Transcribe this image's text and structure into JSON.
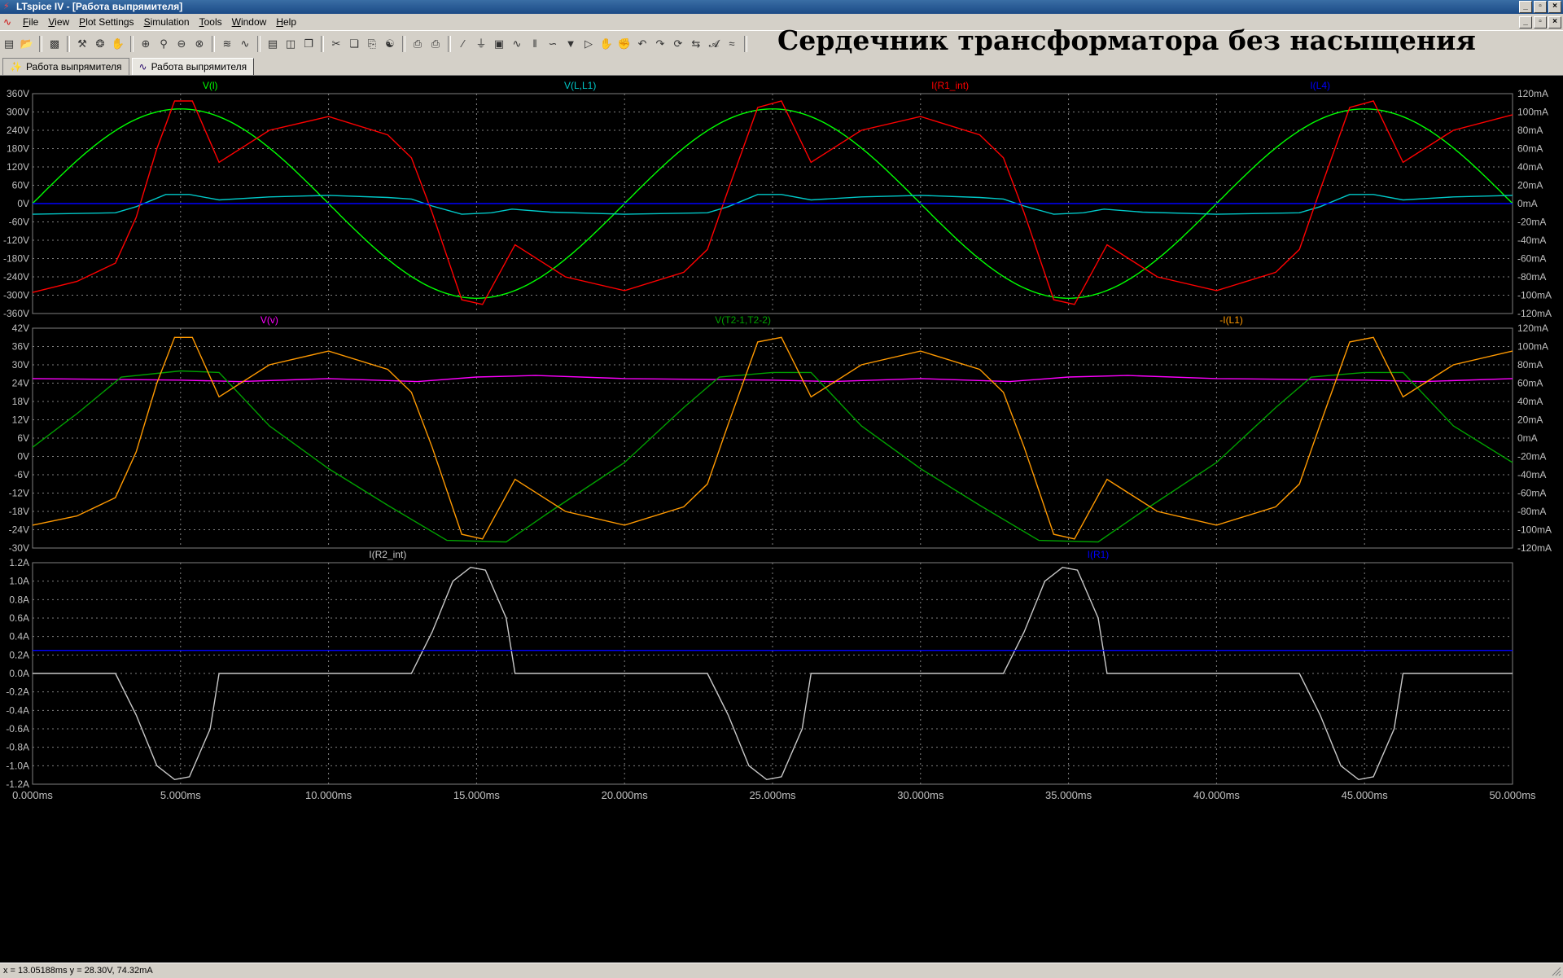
{
  "window": {
    "title": "LTspice IV - [Работа выпрямителя]",
    "controls": [
      "_",
      "▫",
      "×"
    ]
  },
  "menu": {
    "items": [
      "File",
      "View",
      "Plot Settings",
      "Simulation",
      "Tools",
      "Window",
      "Help"
    ]
  },
  "toolbar": {
    "banner": "Сердечник трансформатора без насыщения",
    "icons": [
      "new-schematic-icon",
      "open-icon",
      "save-icon",
      "control-panel-icon",
      "run-icon",
      "halt-icon",
      "zoom-in-icon",
      "zoom-back-icon",
      "zoom-out-icon",
      "zoom-fit-icon",
      "autorange-icon",
      "split-icon",
      "tile-h-icon",
      "tile-v-icon",
      "cascade-icon",
      "cut-icon",
      "copy-icon",
      "paste-icon",
      "find-icon",
      "print-preview-icon",
      "print-icon",
      "wire-icon",
      "ground-icon",
      "label-icon",
      "resistor-icon",
      "capacitor-icon",
      "inductor-icon",
      "diode-icon",
      "component-icon",
      "move-icon",
      "drag-icon",
      "undo-icon",
      "redo-icon",
      "rotate-icon",
      "mirror-icon",
      "text-icon",
      "spice-directive-icon"
    ]
  },
  "tabs": [
    {
      "label": "Работа выпрямителя",
      "icon": "schematic-tab-icon"
    },
    {
      "label": "Работа выпрямителя",
      "icon": "waveform-tab-icon"
    }
  ],
  "status": {
    "cursor": "x = 13.05188ms   y = 28.30V, 74.32mA"
  },
  "chart_data": [
    {
      "type": "line",
      "panel": "top",
      "left_axis": {
        "unit": "V",
        "ylim": [
          -360,
          360
        ],
        "ticks": [
          "360V",
          "300V",
          "240V",
          "180V",
          "120V",
          "60V",
          "0V",
          "-60V",
          "-120V",
          "-180V",
          "-240V",
          "-300V",
          "-360V"
        ]
      },
      "right_axis": {
        "unit": "mA",
        "ylim": [
          -120,
          120
        ],
        "ticks": [
          "120mA",
          "100mA",
          "80mA",
          "60mA",
          "40mA",
          "20mA",
          "0mA",
          "-20mA",
          "-40mA",
          "-60mA",
          "-80mA",
          "-100mA",
          "-120mA"
        ]
      },
      "x": {
        "unit": "ms",
        "xlim": [
          0,
          50
        ]
      },
      "grid": true,
      "series": [
        {
          "name": "V(l)",
          "color": "#00ff00",
          "axis": "left",
          "shape": "sine",
          "amplitude": 310,
          "period_ms": 20,
          "phase_ms": 0
        },
        {
          "name": "V(L,L1)",
          "color": "#00c8c8",
          "axis": "left",
          "shape": "small-distorted",
          "points": [
            [
              0,
              -35
            ],
            [
              2.8,
              -30
            ],
            [
              3.5,
              -10
            ],
            [
              4.5,
              30
            ],
            [
              5.3,
              30
            ],
            [
              6.3,
              12
            ],
            [
              8,
              22
            ],
            [
              10,
              27
            ],
            [
              12,
              20
            ],
            [
              12.8,
              15
            ],
            [
              13.5,
              -8
            ],
            [
              14.5,
              -35
            ],
            [
              15.5,
              -30
            ],
            [
              16.2,
              -18
            ],
            [
              17.5,
              -28
            ],
            [
              20,
              -35
            ],
            [
              22.8,
              -30
            ],
            [
              23.5,
              -10
            ],
            [
              24.5,
              30
            ],
            [
              25.3,
              30
            ],
            [
              26.3,
              12
            ],
            [
              28,
              22
            ],
            [
              30,
              27
            ],
            [
              32,
              20
            ],
            [
              32.8,
              15
            ],
            [
              33.5,
              -8
            ],
            [
              34.5,
              -35
            ],
            [
              35.5,
              -30
            ],
            [
              36.2,
              -18
            ],
            [
              37.5,
              -28
            ],
            [
              40,
              -35
            ],
            [
              42.8,
              -30
            ],
            [
              43.5,
              -10
            ],
            [
              44.5,
              30
            ],
            [
              45.3,
              30
            ],
            [
              46.3,
              12
            ],
            [
              48,
              22
            ],
            [
              50,
              27
            ]
          ]
        },
        {
          "name": "I(R1_int)",
          "color": "#ff0000",
          "axis": "right",
          "points": [
            [
              0,
              -97
            ],
            [
              1.5,
              -85
            ],
            [
              2.8,
              -65
            ],
            [
              3.5,
              -15
            ],
            [
              4.2,
              60
            ],
            [
              4.8,
              112
            ],
            [
              5.4,
              112
            ],
            [
              6.3,
              45
            ],
            [
              8,
              80
            ],
            [
              10,
              95
            ],
            [
              12,
              75
            ],
            [
              12.8,
              50
            ],
            [
              13.5,
              -10
            ],
            [
              14.5,
              -105
            ],
            [
              15.2,
              -110
            ],
            [
              16.3,
              -45
            ],
            [
              18,
              -80
            ],
            [
              20,
              -95
            ],
            [
              22,
              -75
            ],
            [
              22.8,
              -50
            ],
            [
              23.5,
              15
            ],
            [
              24.5,
              105
            ],
            [
              25.3,
              112
            ],
            [
              26.3,
              45
            ],
            [
              28,
              80
            ],
            [
              30,
              95
            ],
            [
              32,
              75
            ],
            [
              32.8,
              50
            ],
            [
              33.5,
              -10
            ],
            [
              34.5,
              -105
            ],
            [
              35.2,
              -110
            ],
            [
              36.3,
              -45
            ],
            [
              38,
              -80
            ],
            [
              40,
              -95
            ],
            [
              42,
              -75
            ],
            [
              42.8,
              -50
            ],
            [
              43.5,
              15
            ],
            [
              44.5,
              105
            ],
            [
              45.3,
              112
            ],
            [
              46.3,
              45
            ],
            [
              48,
              80
            ],
            [
              50,
              97
            ]
          ]
        },
        {
          "name": "I(L4)",
          "color": "#0000ff",
          "axis": "right",
          "points": [
            [
              0,
              0
            ],
            [
              50,
              0
            ]
          ]
        }
      ]
    },
    {
      "type": "line",
      "panel": "middle",
      "left_axis": {
        "unit": "V",
        "ylim": [
          -30,
          42
        ],
        "ticks": [
          "42V",
          "36V",
          "30V",
          "24V",
          "18V",
          "12V",
          "6V",
          "0V",
          "-6V",
          "-12V",
          "-18V",
          "-24V",
          "-30V"
        ]
      },
      "right_axis": {
        "unit": "mA",
        "ylim": [
          -120,
          120
        ],
        "ticks": [
          "120mA",
          "100mA",
          "80mA",
          "60mA",
          "40mA",
          "20mA",
          "0mA",
          "-20mA",
          "-40mA",
          "-60mA",
          "-80mA",
          "-100mA",
          "-120mA"
        ]
      },
      "x": {
        "unit": "ms",
        "xlim": [
          0,
          50
        ]
      },
      "grid": true,
      "series": [
        {
          "name": "V(v)",
          "color": "#ff00ff",
          "axis": "left",
          "points": [
            [
              0,
              25.5
            ],
            [
              5,
              25
            ],
            [
              7,
              24.5
            ],
            [
              10,
              25.5
            ],
            [
              13,
              24.5
            ],
            [
              15,
              26
            ],
            [
              17,
              26.5
            ],
            [
              20,
              25.5
            ],
            [
              25,
              25
            ],
            [
              27,
              24.5
            ],
            [
              30,
              25.5
            ],
            [
              33,
              24.5
            ],
            [
              35,
              26
            ],
            [
              37,
              26.5
            ],
            [
              40,
              25.5
            ],
            [
              45,
              25
            ],
            [
              47,
              24.5
            ],
            [
              50,
              25.5
            ]
          ]
        },
        {
          "name": "V(T2-1,T2-2)",
          "color": "#00a000",
          "axis": "left",
          "points": [
            [
              0,
              3
            ],
            [
              1.5,
              14
            ],
            [
              3,
              26
            ],
            [
              5,
              28
            ],
            [
              6.3,
              27.5
            ],
            [
              8,
              10
            ],
            [
              10,
              -4
            ],
            [
              12,
              -16
            ],
            [
              14,
              -27.5
            ],
            [
              16,
              -28
            ],
            [
              17.5,
              -18
            ],
            [
              20,
              -2
            ],
            [
              22,
              16
            ],
            [
              23.2,
              26
            ],
            [
              25,
              27.5
            ],
            [
              26.3,
              27.5
            ],
            [
              28,
              10
            ],
            [
              30,
              -4
            ],
            [
              32,
              -16
            ],
            [
              34,
              -27.5
            ],
            [
              36,
              -28
            ],
            [
              37.5,
              -18
            ],
            [
              40,
              -2
            ],
            [
              42,
              16
            ],
            [
              43.2,
              26
            ],
            [
              45,
              27.5
            ],
            [
              46.3,
              27.5
            ],
            [
              48,
              10
            ],
            [
              50,
              -2
            ]
          ]
        },
        {
          "name": "-I(L1)",
          "color": "#ff9900",
          "axis": "right",
          "points": [
            [
              0,
              -95
            ],
            [
              1.5,
              -85
            ],
            [
              2.8,
              -65
            ],
            [
              3.5,
              -15
            ],
            [
              4.2,
              60
            ],
            [
              4.8,
              110
            ],
            [
              5.4,
              110
            ],
            [
              6.3,
              45
            ],
            [
              8,
              80
            ],
            [
              10,
              95
            ],
            [
              12,
              75
            ],
            [
              12.8,
              50
            ],
            [
              13.5,
              -10
            ],
            [
              14.5,
              -105
            ],
            [
              15.2,
              -110
            ],
            [
              16.3,
              -45
            ],
            [
              18,
              -80
            ],
            [
              20,
              -95
            ],
            [
              22,
              -75
            ],
            [
              22.8,
              -50
            ],
            [
              23.5,
              15
            ],
            [
              24.5,
              105
            ],
            [
              25.3,
              110
            ],
            [
              26.3,
              45
            ],
            [
              28,
              80
            ],
            [
              30,
              95
            ],
            [
              32,
              75
            ],
            [
              32.8,
              50
            ],
            [
              33.5,
              -10
            ],
            [
              34.5,
              -105
            ],
            [
              35.2,
              -110
            ],
            [
              36.3,
              -45
            ],
            [
              38,
              -80
            ],
            [
              40,
              -95
            ],
            [
              42,
              -75
            ],
            [
              42.8,
              -50
            ],
            [
              43.5,
              15
            ],
            [
              44.5,
              105
            ],
            [
              45.3,
              110
            ],
            [
              46.3,
              45
            ],
            [
              48,
              80
            ],
            [
              50,
              95
            ]
          ]
        }
      ]
    },
    {
      "type": "line",
      "panel": "bottom",
      "left_axis": {
        "unit": "A",
        "ylim": [
          -1.2,
          1.2
        ],
        "ticks": [
          "1.2A",
          "1.0A",
          "0.8A",
          "0.6A",
          "0.4A",
          "0.2A",
          "0.0A",
          "-0.2A",
          "-0.4A",
          "-0.6A",
          "-0.8A",
          "-1.0A",
          "-1.2A"
        ]
      },
      "x": {
        "unit": "ms",
        "xlim": [
          0,
          50
        ],
        "ticks": [
          "0.000ms",
          "5.000ms",
          "10.000ms",
          "15.000ms",
          "20.000ms",
          "25.000ms",
          "30.000ms",
          "35.000ms",
          "40.000ms",
          "45.000ms",
          "50.000ms"
        ]
      },
      "grid": true,
      "series": [
        {
          "name": "I(R2_int)",
          "color": "#c8c8c8",
          "axis": "left",
          "points": [
            [
              0,
              0
            ],
            [
              2.8,
              0
            ],
            [
              3.5,
              -0.45
            ],
            [
              4.2,
              -1.0
            ],
            [
              4.8,
              -1.15
            ],
            [
              5.3,
              -1.12
            ],
            [
              6.0,
              -0.6
            ],
            [
              6.3,
              0
            ],
            [
              12.8,
              0
            ],
            [
              13.5,
              0.45
            ],
            [
              14.2,
              1.0
            ],
            [
              14.8,
              1.15
            ],
            [
              15.3,
              1.12
            ],
            [
              16.0,
              0.6
            ],
            [
              16.3,
              0
            ],
            [
              22.8,
              0
            ],
            [
              23.5,
              -0.45
            ],
            [
              24.2,
              -1.0
            ],
            [
              24.8,
              -1.15
            ],
            [
              25.3,
              -1.12
            ],
            [
              26.0,
              -0.6
            ],
            [
              26.3,
              0
            ],
            [
              32.8,
              0
            ],
            [
              33.5,
              0.45
            ],
            [
              34.2,
              1.0
            ],
            [
              34.8,
              1.15
            ],
            [
              35.3,
              1.12
            ],
            [
              36.0,
              0.6
            ],
            [
              36.3,
              0
            ],
            [
              42.8,
              0
            ],
            [
              43.5,
              -0.45
            ],
            [
              44.2,
              -1.0
            ],
            [
              44.8,
              -1.15
            ],
            [
              45.3,
              -1.12
            ],
            [
              46.0,
              -0.6
            ],
            [
              46.3,
              0
            ],
            [
              50,
              0
            ]
          ]
        },
        {
          "name": "I(R1)",
          "color": "#0000ff",
          "axis": "left",
          "points": [
            [
              0,
              0.25
            ],
            [
              50,
              0.25
            ]
          ]
        }
      ]
    }
  ]
}
